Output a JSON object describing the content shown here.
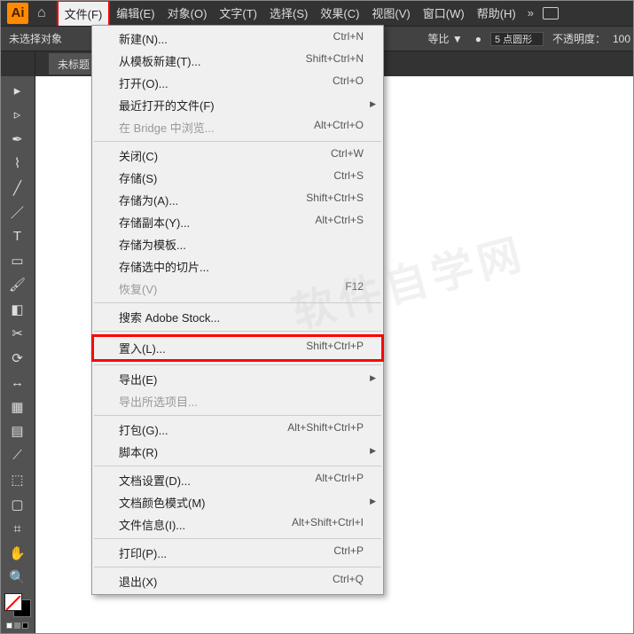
{
  "app": {
    "logo": "Ai"
  },
  "menu": {
    "items": [
      "文件(F)",
      "编辑(E)",
      "对象(O)",
      "文字(T)",
      "选择(S)",
      "效果(C)",
      "视图(V)",
      "窗口(W)",
      "帮助(H)"
    ],
    "active_index": 0
  },
  "options_bar": {
    "no_selection": "未选择对象",
    "equal_ratio": "等比 ▼",
    "dot": "●",
    "stroke_text": "5 点圆形",
    "opacity_label": "不透明度：",
    "opacity_value": "100"
  },
  "doc_tab": "未标题",
  "dropdown": {
    "groups": [
      [
        {
          "label": "新建(N)...",
          "shortcut": "Ctrl+N"
        },
        {
          "label": "从模板新建(T)...",
          "shortcut": "Shift+Ctrl+N"
        },
        {
          "label": "打开(O)...",
          "shortcut": "Ctrl+O"
        },
        {
          "label": "最近打开的文件(F)",
          "sub": true
        },
        {
          "label": "在 Bridge 中浏览...",
          "shortcut": "Alt+Ctrl+O",
          "disabled": true
        }
      ],
      [
        {
          "label": "关闭(C)",
          "shortcut": "Ctrl+W"
        },
        {
          "label": "存储(S)",
          "shortcut": "Ctrl+S"
        },
        {
          "label": "存储为(A)...",
          "shortcut": "Shift+Ctrl+S"
        },
        {
          "label": "存储副本(Y)...",
          "shortcut": "Alt+Ctrl+S"
        },
        {
          "label": "存储为模板..."
        },
        {
          "label": "存储选中的切片..."
        },
        {
          "label": "恢复(V)",
          "shortcut": "F12",
          "disabled": true
        }
      ],
      [
        {
          "label": "搜索 Adobe Stock..."
        }
      ],
      [
        {
          "label": "置入(L)...",
          "shortcut": "Shift+Ctrl+P",
          "highlight": true
        }
      ],
      [
        {
          "label": "导出(E)",
          "sub": true
        },
        {
          "label": "导出所选项目...",
          "disabled": true
        }
      ],
      [
        {
          "label": "打包(G)...",
          "shortcut": "Alt+Shift+Ctrl+P"
        },
        {
          "label": "脚本(R)",
          "sub": true
        }
      ],
      [
        {
          "label": "文档设置(D)...",
          "shortcut": "Alt+Ctrl+P"
        },
        {
          "label": "文档颜色模式(M)",
          "sub": true
        },
        {
          "label": "文件信息(I)...",
          "shortcut": "Alt+Shift+Ctrl+I"
        }
      ],
      [
        {
          "label": "打印(P)...",
          "shortcut": "Ctrl+P"
        }
      ],
      [
        {
          "label": "退出(X)",
          "shortcut": "Ctrl+Q"
        }
      ]
    ]
  },
  "tools": [
    "selection",
    "direct-select",
    "pen",
    "curvature",
    "line",
    "brush",
    "type",
    "rectangle",
    "paintbrush",
    "eraser",
    "scissors",
    "rotate",
    "width",
    "mesh",
    "gradient",
    "eyedropper",
    "blend",
    "artboard",
    "slice",
    "hand",
    "zoom"
  ],
  "watermark": "软件自学网"
}
